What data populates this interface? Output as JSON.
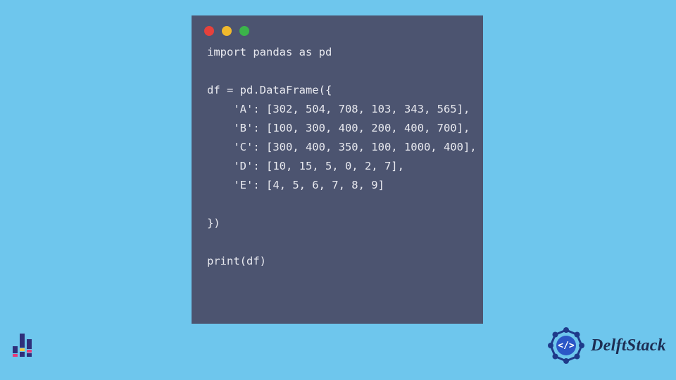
{
  "code": {
    "lines": [
      "import pandas as pd",
      "",
      "df = pd.DataFrame({",
      "    'A': [302, 504, 708, 103, 343, 565],",
      "    'B': [100, 300, 400, 200, 400, 700],",
      "    'C': [300, 400, 350, 100, 1000, 400],",
      "    'D': [10, 15, 5, 0, 2, 7],",
      "    'E': [4, 5, 6, 7, 8, 9]",
      "",
      "})",
      "",
      "print(df)"
    ]
  },
  "window": {
    "dots": [
      "red",
      "yellow",
      "green"
    ]
  },
  "branding": {
    "right_text": "DelftStack"
  },
  "chart_data": {
    "type": "table",
    "title": "DataFrame df",
    "columns": [
      "A",
      "B",
      "C",
      "D",
      "E"
    ],
    "rows": [
      [
        302,
        100,
        300,
        10,
        4
      ],
      [
        504,
        300,
        400,
        15,
        5
      ],
      [
        708,
        400,
        350,
        5,
        6
      ],
      [
        103,
        200,
        100,
        0,
        7
      ],
      [
        343,
        400,
        1000,
        2,
        8
      ],
      [
        565,
        700,
        400,
        7,
        9
      ]
    ]
  }
}
